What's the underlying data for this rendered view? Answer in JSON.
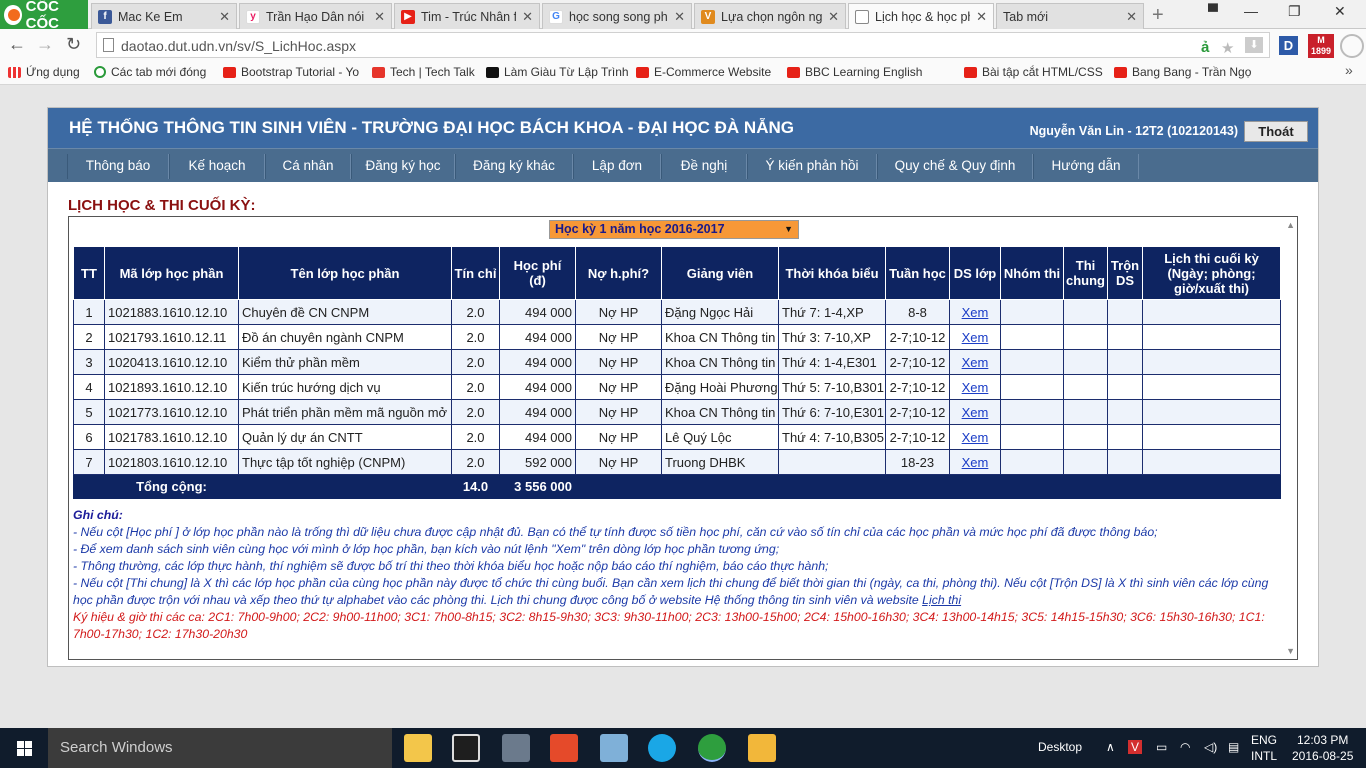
{
  "browser": {
    "brand": "CỐC CỐC",
    "tabs": [
      {
        "label": "Mac Ke Em"
      },
      {
        "label": "Trần Hạo Dân nói c"
      },
      {
        "label": "Tim - Trúc Nhân ft"
      },
      {
        "label": "học song song phả"
      },
      {
        "label": "Lựa chọn ngôn ngữ"
      },
      {
        "label": "Lịch học & học phí"
      },
      {
        "label": "Tab mới"
      }
    ],
    "url": "daotao.dut.udn.vn/sv/S_LichHoc.aspx",
    "ext_d": "D",
    "ext_m_line1": "M",
    "ext_m_line2": "1899",
    "bookmarks": [
      "Ứng dụng",
      "Các tab mới đóng",
      "Bootstrap Tutorial - Yo",
      "Tech | Tech Talk",
      "Làm Giàu Từ Lập Trình",
      "E-Commerce Website",
      "BBC Learning English",
      "",
      "Bài tập cắt HTML/CSS",
      "Bang Bang - Trần Ngọ"
    ]
  },
  "header": {
    "title": "HỆ THỐNG THÔNG TIN SINH VIÊN - TRƯỜNG ĐẠI HỌC BÁCH KHOA - ĐẠI HỌC ĐÀ NẴNG",
    "user": "Nguyễn Văn Lin - 12T2 (102120143)",
    "logout": "Thoát"
  },
  "menu": [
    "Thông báo",
    "Kế hoạch",
    "Cá nhân",
    "Đăng ký học",
    "Đăng ký khác",
    "Lập đơn",
    "Đề nghị",
    "Ý kiến phản hồi",
    "Quy chế & Quy định",
    "Hướng dẫn"
  ],
  "section_title": "LỊCH HỌC & THI CUỐI KỲ:",
  "semester": "Học kỳ 1 năm học 2016-2017",
  "table": {
    "headers": {
      "tt": "TT",
      "code": "Mã lớp học phần",
      "name": "Tên lớp học phần",
      "credits": "Tín chỉ",
      "fee_line1": "Học phí",
      "fee_line2": "(đ)",
      "debt": "Nợ h.phí?",
      "lecturer": "Giảng viên",
      "schedule": "Thời khóa biểu",
      "weeks": "Tuần học",
      "list": "DS lớp",
      "exam_group": "Nhóm thi",
      "common_exam_line1": "Thi",
      "common_exam_line2": "chung",
      "merge_line1": "Trộn",
      "merge_line2": "DS",
      "final_exam_line1": "Lịch thi cuối kỳ",
      "final_exam_line2": "(Ngày; phòng;",
      "final_exam_line3": "giờ/xuất thi)"
    },
    "rows": [
      {
        "tt": "1",
        "code": "1021883.1610.12.10",
        "name": "Chuyên đề CN CNPM",
        "credits": "2.0",
        "fee": "494 000",
        "debt": "Nợ HP",
        "lecturer": "Đặng Ngọc Hải",
        "schedule": "Thứ 7: 1-4,XP",
        "weeks": "8-8",
        "link": "Xem",
        "exam_group": "",
        "common": "",
        "merge": "",
        "final": ""
      },
      {
        "tt": "2",
        "code": "1021793.1610.12.11",
        "name": "Đồ án chuyên ngành CNPM",
        "credits": "2.0",
        "fee": "494 000",
        "debt": "Nợ HP",
        "lecturer": "Khoa CN Thông tin",
        "schedule": "Thứ 3: 7-10,XP",
        "weeks": "2-7;10-12",
        "link": "Xem",
        "exam_group": "",
        "common": "",
        "merge": "",
        "final": ""
      },
      {
        "tt": "3",
        "code": "1020413.1610.12.10",
        "name": "Kiểm thử phần mềm",
        "credits": "2.0",
        "fee": "494 000",
        "debt": "Nợ HP",
        "lecturer": "Khoa CN Thông tin",
        "schedule": "Thứ 4: 1-4,E301",
        "weeks": "2-7;10-12",
        "link": "Xem",
        "exam_group": "",
        "common": "",
        "merge": "",
        "final": ""
      },
      {
        "tt": "4",
        "code": "1021893.1610.12.10",
        "name": "Kiến trúc hướng dịch vụ",
        "credits": "2.0",
        "fee": "494 000",
        "debt": "Nợ HP",
        "lecturer": "Đặng Hoài Phương",
        "schedule": "Thứ 5: 7-10,B301",
        "weeks": "2-7;10-12",
        "link": "Xem",
        "exam_group": "",
        "common": "",
        "merge": "",
        "final": ""
      },
      {
        "tt": "5",
        "code": "1021773.1610.12.10",
        "name": "Phát triển phần mềm mã nguồn mở",
        "credits": "2.0",
        "fee": "494 000",
        "debt": "Nợ HP",
        "lecturer": "Khoa CN Thông tin",
        "schedule": "Thứ 6: 7-10,E301",
        "weeks": "2-7;10-12",
        "link": "Xem",
        "exam_group": "",
        "common": "",
        "merge": "",
        "final": ""
      },
      {
        "tt": "6",
        "code": "1021783.1610.12.10",
        "name": "Quản lý dự án CNTT",
        "credits": "2.0",
        "fee": "494 000",
        "debt": "Nợ HP",
        "lecturer": "Lê Quý Lộc",
        "schedule": "Thứ 4: 7-10,B305",
        "weeks": "2-7;10-12",
        "link": "Xem",
        "exam_group": "",
        "common": "",
        "merge": "",
        "final": ""
      },
      {
        "tt": "7",
        "code": "1021803.1610.12.10",
        "name": "Thực tập tốt nghiệp (CNPM)",
        "credits": "2.0",
        "fee": "592 000",
        "debt": "Nợ HP",
        "lecturer": "Truong DHBK",
        "schedule": "",
        "weeks": "18-23",
        "link": "Xem",
        "exam_group": "",
        "common": "",
        "merge": "",
        "final": ""
      }
    ],
    "total_label": "Tổng cộng:",
    "total_credits": "14.0",
    "total_fee": "3 556 000"
  },
  "notes": {
    "heading": "Ghi chú:",
    "line1": "- Nếu cột [Học phí ] ở lớp học phần nào là trống thì dữ liệu chưa được cập nhật đủ. Bạn có thể tự tính được số tiền học phí, căn cứ vào số tín chỉ của các học phần và mức học phí đã được thông báo;",
    "line2": "- Để xem danh sách sinh viên cùng học với mình ở lớp học phần, bạn kích vào nút lệnh \"Xem\" trên dòng lớp học phần tương ứng;",
    "line3": "- Thông thường, các lớp thực hành, thí nghiệm sẽ được bố trí thi theo thời khóa biểu học hoặc nộp báo cáo thí nghiệm, báo cáo thực hành;",
    "line4": "- Nếu cột [Thi chung] là X thì các lớp học phần của cùng học phần này được tổ chức thi cùng buổi. Bạn cần xem lịch thi chung để biết thời gian thi (ngày, ca thi, phòng thi). Nếu cột [Trộn DS] là X thì sinh viên các lớp cùng học phần được trộn với nhau và xếp theo thứ tự alphabet vào các phòng thi. Lịch thi chung được công bố ở website Hệ thống thông tin sinh viên và website ",
    "line4_link": "Lịch thi",
    "line5": "Ký hiệu & giờ thi các ca: 2C1: 7h00-9h00; 2C2: 9h00-11h00; 3C1: 7h00-8h15; 3C2: 8h15-9h30; 3C3: 9h30-11h00; 2C3: 13h00-15h00; 2C4: 15h00-16h30; 3C4: 13h00-14h15; 3C5: 14h15-15h30; 3C6: 15h30-16h30; 1C1: 7h00-17h30; 1C2: 17h30-20h30"
  },
  "taskbar": {
    "search_placeholder": "Search Windows",
    "desktop": "Desktop",
    "lang1": "ENG",
    "lang2": "INTL",
    "time": "12:03 PM",
    "date": "2016-08-25"
  },
  "colors": {
    "header_blue": "#3c6aa3",
    "menu_blue": "#4a6c8e",
    "table_header": "#0e2461",
    "section_red": "#8a1010",
    "semester_orange": "#f79837"
  }
}
